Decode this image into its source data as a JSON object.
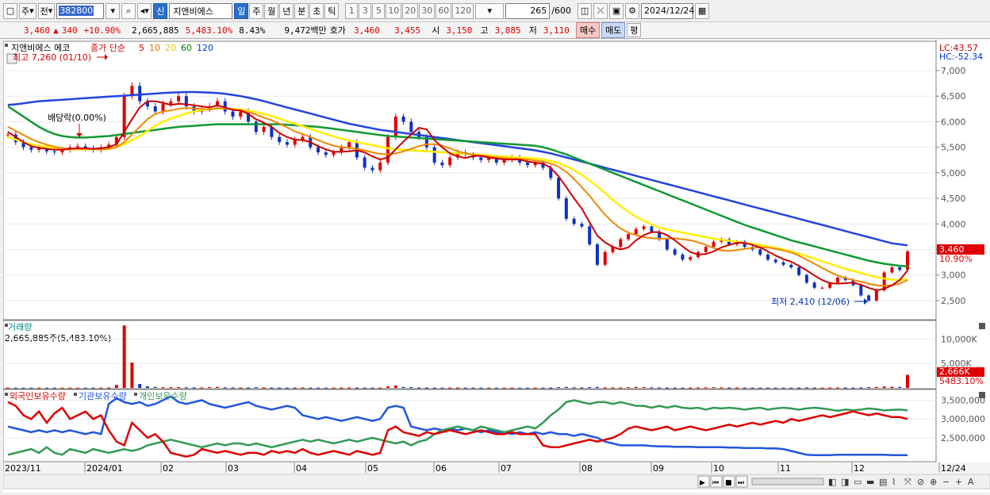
{
  "toolbar": {
    "market_label": "주",
    "prev_label": "전",
    "code": "382800",
    "stock_name": "지앤비에스 에코",
    "new_badge": "신",
    "name_box": "지앤비에스",
    "period_tabs": [
      "일",
      "주",
      "월",
      "년",
      "분",
      "초",
      "틱"
    ],
    "active_period": "일",
    "intervals": [
      "1",
      "3",
      "5",
      "10",
      "20",
      "30",
      "60",
      "120"
    ],
    "count": "265",
    "count_max": "/600",
    "date": "2024/12/24"
  },
  "info": {
    "price": "3,460",
    "change_arrow": "▲",
    "change": "340",
    "change_pct": "+10.90%",
    "volume": "2,665,885",
    "volume_ratio": "5,483.10%",
    "turnover": "8.43%",
    "amount": "9,472백만",
    "bid_label": "호가",
    "bid1": "3,460",
    "bid2": "3,455",
    "open_label": "시",
    "open": "3,150",
    "high_label": "고",
    "high": "3,885",
    "low_label": "저",
    "low": "3,110",
    "buy_label": "매수",
    "sell_label": "매도",
    "avg_label": "평"
  },
  "chart_data": {
    "type": "line",
    "title": "지앤비에스 에코",
    "legend": [
      "종가 단순",
      "5",
      "10",
      "20",
      "60",
      "120"
    ],
    "legend_colors": {
      "종가 단순": "#cc0000",
      "5": "#cc0000",
      "10": "#e07000",
      "20": "#f0e000",
      "60": "#008000",
      "120": "#0033dd"
    },
    "price_axis": [
      "7,000",
      "6,500",
      "6,000",
      "5,500",
      "5,000",
      "4,500",
      "4,000",
      "3,500",
      "3,000",
      "2,500"
    ],
    "ylim": [
      2250,
      7450
    ],
    "lc_label": "LC:43.57",
    "hc_label": "HC:-52.34",
    "current_price_label": "3,460",
    "current_pct_label": "10.90%",
    "annotations": {
      "high": "최고 7,260 (01/10)",
      "low": "최저 2,410 (12/06)",
      "dividend": "배당락(0.00%)"
    },
    "x_labels": [
      "2023/11",
      "2024/01",
      "02",
      "03",
      "04",
      "05",
      "06",
      "07",
      "08",
      "09",
      "10",
      "11",
      "12",
      "12/24"
    ],
    "close": [
      5750,
      5600,
      5500,
      5450,
      5480,
      5420,
      5400,
      5450,
      5500,
      5520,
      5480,
      5450,
      5500,
      5550,
      5700,
      6500,
      6700,
      6400,
      6300,
      6200,
      6350,
      6400,
      6500,
      6300,
      6200,
      6250,
      6300,
      6400,
      6200,
      6100,
      6200,
      6000,
      5800,
      5900,
      5700,
      5600,
      5550,
      5650,
      5700,
      5500,
      5400,
      5350,
      5400,
      5500,
      5600,
      5300,
      5100,
      5050,
      5200,
      5700,
      6100,
      6000,
      5800,
      5700,
      5500,
      5200,
      5150,
      5300,
      5400,
      5350,
      5300,
      5250,
      5300,
      5200,
      5250,
      5300,
      5200,
      5150,
      5200,
      5100,
      4900,
      4500,
      4100,
      4000,
      3950,
      3600,
      3200,
      3450,
      3550,
      3700,
      3800,
      3900,
      3950,
      3850,
      3700,
      3500,
      3400,
      3300,
      3350,
      3450,
      3550,
      3650,
      3700,
      3600,
      3650,
      3550,
      3500,
      3400,
      3300,
      3250,
      3200,
      3150,
      3000,
      2850,
      2750,
      2750,
      2850,
      2950,
      2900,
      2800,
      2600,
      2500,
      2700,
      3050,
      3150,
      3100,
      3460
    ],
    "ma5": [
      5800,
      5700,
      5600,
      5520,
      5490,
      5470,
      5450,
      5450,
      5470,
      5480,
      5480,
      5470,
      5480,
      5500,
      5560,
      5800,
      6050,
      6280,
      6400,
      6400,
      6370,
      6330,
      6350,
      6340,
      6320,
      6300,
      6280,
      6320,
      6280,
      6230,
      6220,
      6150,
      6050,
      5980,
      5900,
      5780,
      5700,
      5650,
      5640,
      5600,
      5520,
      5460,
      5410,
      5410,
      5420,
      5440,
      5400,
      5320,
      5260,
      5300,
      5460,
      5610,
      5750,
      5880,
      5850,
      5640,
      5500,
      5380,
      5320,
      5290,
      5330,
      5330,
      5300,
      5280,
      5260,
      5260,
      5260,
      5220,
      5200,
      5180,
      5100,
      4930,
      4720,
      4500,
      4300,
      4030,
      3770,
      3640,
      3550,
      3500,
      3540,
      3680,
      3780,
      3840,
      3840,
      3780,
      3680,
      3560,
      3450,
      3400,
      3410,
      3460,
      3540,
      3590,
      3630,
      3630,
      3590,
      3540,
      3460,
      3380,
      3310,
      3260,
      3180,
      3090,
      2990,
      2900,
      2840,
      2830,
      2840,
      2850,
      2810,
      2750,
      2700,
      2730,
      2800,
      2900,
      3090
    ],
    "ma10": [
      5900,
      5820,
      5740,
      5660,
      5600,
      5550,
      5510,
      5480,
      5470,
      5470,
      5470,
      5460,
      5460,
      5470,
      5500,
      5600,
      5750,
      5900,
      6050,
      6150,
      6200,
      6220,
      6250,
      6270,
      6260,
      6250,
      6240,
      6260,
      6260,
      6240,
      6220,
      6190,
      6140,
      6080,
      6030,
      5960,
      5890,
      5810,
      5760,
      5700,
      5640,
      5580,
      5530,
      5500,
      5490,
      5470,
      5440,
      5400,
      5370,
      5360,
      5380,
      5420,
      5470,
      5520,
      5560,
      5560,
      5530,
      5480,
      5420,
      5380,
      5360,
      5340,
      5320,
      5300,
      5290,
      5280,
      5270,
      5260,
      5240,
      5220,
      5180,
      5120,
      5020,
      4880,
      4720,
      4550,
      4360,
      4180,
      4030,
      3910,
      3830,
      3780,
      3740,
      3720,
      3710,
      3710,
      3720,
      3700,
      3680,
      3640,
      3590,
      3530,
      3480,
      3470,
      3490,
      3510,
      3530,
      3540,
      3540,
      3510,
      3480,
      3440,
      3380,
      3300,
      3220,
      3140,
      3060,
      2990,
      2940,
      2900,
      2870,
      2830,
      2800,
      2790,
      2800,
      2830,
      2900
    ],
    "ma20": [
      5700,
      5650,
      5600,
      5560,
      5530,
      5510,
      5490,
      5470,
      5460,
      5460,
      5460,
      5460,
      5460,
      5470,
      5500,
      5560,
      5640,
      5720,
      5820,
      5920,
      6000,
      6060,
      6110,
      6160,
      6200,
      6230,
      6250,
      6260,
      6260,
      6250,
      6240,
      6220,
      6190,
      6150,
      6110,
      6060,
      6010,
      5960,
      5910,
      5860,
      5810,
      5760,
      5710,
      5670,
      5630,
      5600,
      5570,
      5540,
      5510,
      5480,
      5460,
      5450,
      5440,
      5430,
      5420,
      5410,
      5400,
      5390,
      5380,
      5370,
      5360,
      5350,
      5340,
      5330,
      5320,
      5310,
      5300,
      5290,
      5280,
      5260,
      5230,
      5190,
      5130,
      5050,
      4960,
      4850,
      4730,
      4600,
      4470,
      4350,
      4240,
      4140,
      4060,
      3990,
      3930,
      3890,
      3860,
      3830,
      3800,
      3770,
      3740,
      3710,
      3690,
      3670,
      3650,
      3630,
      3610,
      3590,
      3560,
      3530,
      3500,
      3460,
      3420,
      3370,
      3320,
      3270,
      3220,
      3170,
      3120,
      3080,
      3040,
      3000,
      2960,
      2930,
      2910,
      2900,
      2920
    ],
    "ma60": [
      6300,
      6200,
      6100,
      6000,
      5900,
      5820,
      5760,
      5720,
      5700,
      5690,
      5690,
      5700,
      5710,
      5720,
      5740,
      5760,
      5780,
      5800,
      5820,
      5840,
      5860,
      5880,
      5900,
      5910,
      5920,
      5930,
      5940,
      5950,
      5950,
      5950,
      5950,
      5950,
      5950,
      5950,
      5950,
      5950,
      5940,
      5930,
      5920,
      5910,
      5900,
      5880,
      5860,
      5840,
      5820,
      5800,
      5780,
      5760,
      5740,
      5720,
      5710,
      5700,
      5690,
      5680,
      5670,
      5660,
      5650,
      5640,
      5630,
      5620,
      5610,
      5600,
      5590,
      5580,
      5570,
      5560,
      5550,
      5540,
      5530,
      5500,
      5460,
      5410,
      5360,
      5300,
      5240,
      5180,
      5120,
      5060,
      5000,
      4940,
      4880,
      4820,
      4760,
      4700,
      4640,
      4580,
      4520,
      4460,
      4400,
      4340,
      4280,
      4220,
      4160,
      4100,
      4040,
      3980,
      3930,
      3880,
      3830,
      3780,
      3730,
      3680,
      3640,
      3600,
      3560,
      3520,
      3480,
      3440,
      3400,
      3360,
      3320,
      3280,
      3250,
      3220,
      3200,
      3180,
      3170
    ],
    "ma120": [
      6330,
      6340,
      6360,
      6380,
      6400,
      6410,
      6420,
      6430,
      6440,
      6450,
      6460,
      6470,
      6480,
      6490,
      6500,
      6510,
      6520,
      6530,
      6540,
      6550,
      6560,
      6570,
      6575,
      6580,
      6580,
      6575,
      6570,
      6560,
      6545,
      6525,
      6500,
      6470,
      6440,
      6400,
      6360,
      6320,
      6280,
      6240,
      6200,
      6160,
      6120,
      6080,
      6040,
      6000,
      5960,
      5930,
      5900,
      5870,
      5840,
      5820,
      5800,
      5780,
      5760,
      5740,
      5720,
      5700,
      5680,
      5660,
      5640,
      5620,
      5600,
      5580,
      5560,
      5540,
      5520,
      5500,
      5480,
      5460,
      5440,
      5410,
      5380,
      5340,
      5300,
      5260,
      5220,
      5180,
      5140,
      5100,
      5060,
      5020,
      4980,
      4940,
      4900,
      4860,
      4820,
      4780,
      4740,
      4700,
      4660,
      4620,
      4580,
      4540,
      4500,
      4460,
      4420,
      4380,
      4340,
      4300,
      4260,
      4220,
      4180,
      4140,
      4100,
      4060,
      4020,
      3980,
      3940,
      3900,
      3860,
      3820,
      3780,
      3740,
      3700,
      3660,
      3620,
      3600,
      3580
    ],
    "volume_title": "거래량",
    "volume_label": "2,665,885주(5,483.10%)",
    "volume_axis": [
      "10,000K",
      "5,000K"
    ],
    "volume_current": "2,666K",
    "volume_pct": "5483.10%",
    "volume_ylim": [
      0,
      13000
    ],
    "volume": [
      60,
      50,
      40,
      45,
      50,
      40,
      30,
      35,
      40,
      35,
      40,
      45,
      50,
      80,
      600,
      12800,
      5200,
      800,
      300,
      200,
      150,
      150,
      180,
      120,
      100,
      100,
      150,
      200,
      120,
      100,
      90,
      80,
      150,
      100,
      80,
      70,
      60,
      80,
      100,
      60,
      50,
      40,
      50,
      80,
      100,
      80,
      60,
      50,
      60,
      300,
      500,
      200,
      150,
      100,
      80,
      60,
      50,
      70,
      80,
      60,
      50,
      50,
      60,
      50,
      50,
      60,
      50,
      40,
      50,
      50,
      80,
      150,
      200,
      120,
      100,
      150,
      200,
      120,
      100,
      90,
      150,
      200,
      180,
      120,
      100,
      80,
      70,
      60,
      80,
      100,
      120,
      140,
      120,
      90,
      100,
      80,
      70,
      60,
      60,
      50,
      50,
      60,
      80,
      100,
      80,
      70,
      90,
      100,
      80,
      70,
      100,
      150,
      200,
      300,
      250,
      200,
      2666
    ],
    "holders_legend": [
      "외국인보유수량",
      "기관보유수량",
      "개인보유수량"
    ],
    "holders_colors": [
      "#dd0000",
      "#2255dd",
      "#339955"
    ],
    "holders_axis": [
      "3,500,000",
      "3,000,000",
      "2,500,000"
    ],
    "holders_ylim": [
      1950000,
      3700000
    ],
    "foreign": [
      3450000,
      3350000,
      3100000,
      3000000,
      3200000,
      2900000,
      3150000,
      3300000,
      3000000,
      3100000,
      3200000,
      3000000,
      3100000,
      2700000,
      2400000,
      2300000,
      2900000,
      2700000,
      2500000,
      2600000,
      2400000,
      2100000,
      2050000,
      2000000,
      2050000,
      2200000,
      2150000,
      2100000,
      2150000,
      2100000,
      2050000,
      2100000,
      2100000,
      2050000,
      2150000,
      2100000,
      2150000,
      2100000,
      2200000,
      2100000,
      2050000,
      2100000,
      2150000,
      2100000,
      2050000,
      2150000,
      2100000,
      2050000,
      2100000,
      2700000,
      2800000,
      2650000,
      2600000,
      2550000,
      2650000,
      2600000,
      2650000,
      2700000,
      2650000,
      2600000,
      2650000,
      2700000,
      2650000,
      2600000,
      2600000,
      2650000,
      2600000,
      2600000,
      2600000,
      2300000,
      2250000,
      2250000,
      2300000,
      2350000,
      2400000,
      2450000,
      2400000,
      2450000,
      2500000,
      2600000,
      2750000,
      2800000,
      2750000,
      2700000,
      2750000,
      2800000,
      2700000,
      2750000,
      2800000,
      2750000,
      2700000,
      2750000,
      2800000,
      2850000,
      2800000,
      2850000,
      2900000,
      2850000,
      2900000,
      2950000,
      2900000,
      3000000,
      2950000,
      3000000,
      3050000,
      3100000,
      3050000,
      3100000,
      3150000,
      3200000,
      3150000,
      3100000,
      3150000,
      3100000,
      3050000,
      3050000,
      3000000
    ],
    "institution": [
      2800000,
      2750000,
      2700000,
      2650000,
      2700000,
      2650000,
      2700000,
      2650000,
      2700000,
      2650000,
      2600000,
      2650000,
      2600000,
      3400000,
      3550000,
      3450000,
      3400000,
      3450000,
      3350000,
      3400000,
      3500000,
      3600000,
      3450000,
      3400000,
      3450000,
      3500000,
      3400000,
      3350000,
      3300000,
      3350000,
      3400000,
      3450000,
      3350000,
      3300000,
      3250000,
      3300000,
      3350000,
      3300000,
      3100000,
      3050000,
      3000000,
      3050000,
      3000000,
      2950000,
      3000000,
      3050000,
      3000000,
      2950000,
      3000000,
      3300000,
      3350000,
      3300000,
      2800000,
      2750000,
      2700000,
      2750000,
      2700000,
      2750000,
      2700000,
      2750000,
      2700000,
      2650000,
      2700000,
      2650000,
      2650000,
      2600000,
      2650000,
      2600000,
      2650000,
      2600000,
      2650000,
      2600000,
      2600000,
      2550000,
      2600000,
      2550000,
      2500000,
      2400000,
      2350000,
      2300000,
      2300000,
      2300000,
      2300000,
      2280000,
      2270000,
      2270000,
      2260000,
      2260000,
      2260000,
      2250000,
      2250000,
      2250000,
      2250000,
      2240000,
      2240000,
      2230000,
      2230000,
      2230000,
      2220000,
      2220000,
      2200000,
      2150000,
      2100000,
      2050000,
      2040000,
      2040000,
      2040000,
      2050000,
      2050000,
      2050000,
      2050000,
      2050000,
      2050000,
      2050000,
      2040000,
      2040000,
      2040000
    ],
    "individual": [
      2050000,
      2100000,
      2150000,
      2200000,
      2100000,
      2250000,
      2100000,
      2050000,
      2200000,
      2150000,
      2100000,
      2200000,
      2150000,
      2100000,
      2150000,
      2200000,
      2150000,
      2200000,
      2300000,
      2350000,
      2400000,
      2450000,
      2400000,
      2350000,
      2300000,
      2250000,
      2300000,
      2350000,
      2300000,
      2350000,
      2350000,
      2300000,
      2350000,
      2300000,
      2250000,
      2300000,
      2350000,
      2400000,
      2450000,
      2400000,
      2450000,
      2400000,
      2350000,
      2400000,
      2450000,
      2400000,
      2450000,
      2500000,
      2450000,
      2400000,
      2350000,
      2400000,
      2300000,
      2400000,
      2450000,
      2600000,
      2700000,
      2750000,
      2800000,
      2750000,
      2700000,
      2800000,
      2750000,
      2700000,
      2650000,
      2700000,
      2750000,
      2800000,
      2750000,
      2900000,
      3100000,
      3250000,
      3450000,
      3500000,
      3450000,
      3400000,
      3450000,
      3450000,
      3400000,
      3450000,
      3400000,
      3350000,
      3350000,
      3300000,
      3350000,
      3300000,
      3350000,
      3300000,
      3280000,
      3300000,
      3250000,
      3300000,
      3280000,
      3300000,
      3280000,
      3250000,
      3280000,
      3300000,
      3250000,
      3280000,
      3300000,
      3280000,
      3250000,
      3280000,
      3300000,
      3280000,
      3250000,
      3220000,
      3250000,
      3230000,
      3250000,
      3280000,
      3260000,
      3230000,
      3240000,
      3250000,
      3230000
    ]
  },
  "statusbar": {
    "nav_icons": [
      "scroll-right-icon",
      "first-icon",
      "stop-icon",
      "last-icon"
    ]
  }
}
